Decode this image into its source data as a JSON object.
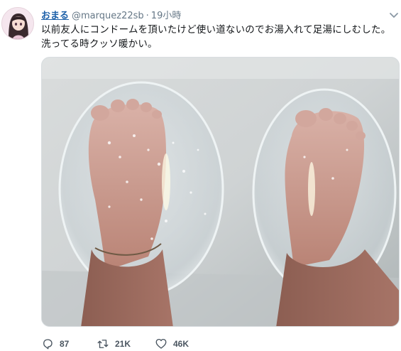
{
  "tweet": {
    "display_name": "おまる",
    "handle": "@marquez22sb",
    "separator": "·",
    "time": "19小時",
    "text": "以前友人にコンドームを頂いたけど使い道ないのでお湯入れて足湯にしむした。\n洗ってる時クッソ暖かい。",
    "photo_icon": "foot-bath-photo",
    "actions": {
      "reply_count": "87",
      "retweet_count": "21K",
      "like_count": "46K"
    }
  },
  "colors": {
    "name": "#1b5fa8",
    "muted": "#657786"
  }
}
